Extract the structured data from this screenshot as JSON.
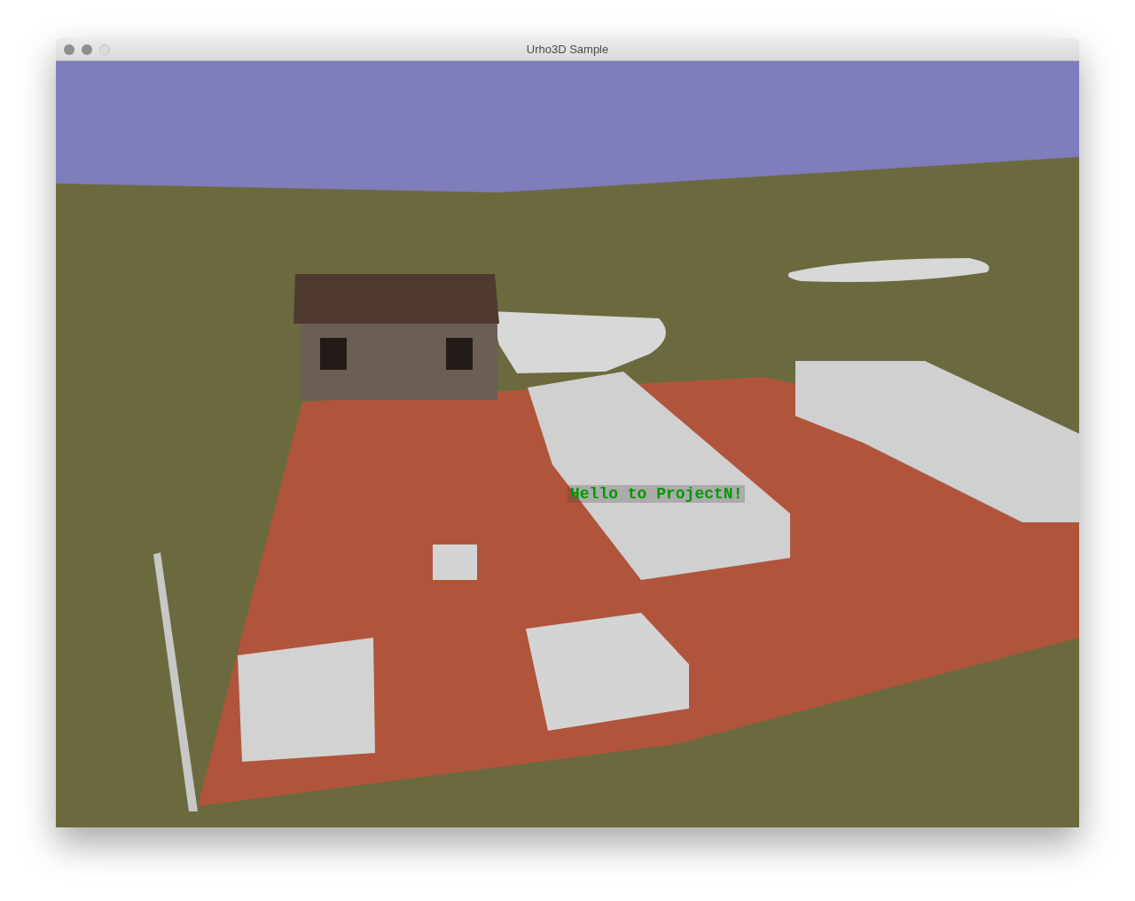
{
  "window": {
    "title": "Urho3D Sample"
  },
  "viewport": {
    "overlay_text": "Hello to ProjectN!"
  }
}
